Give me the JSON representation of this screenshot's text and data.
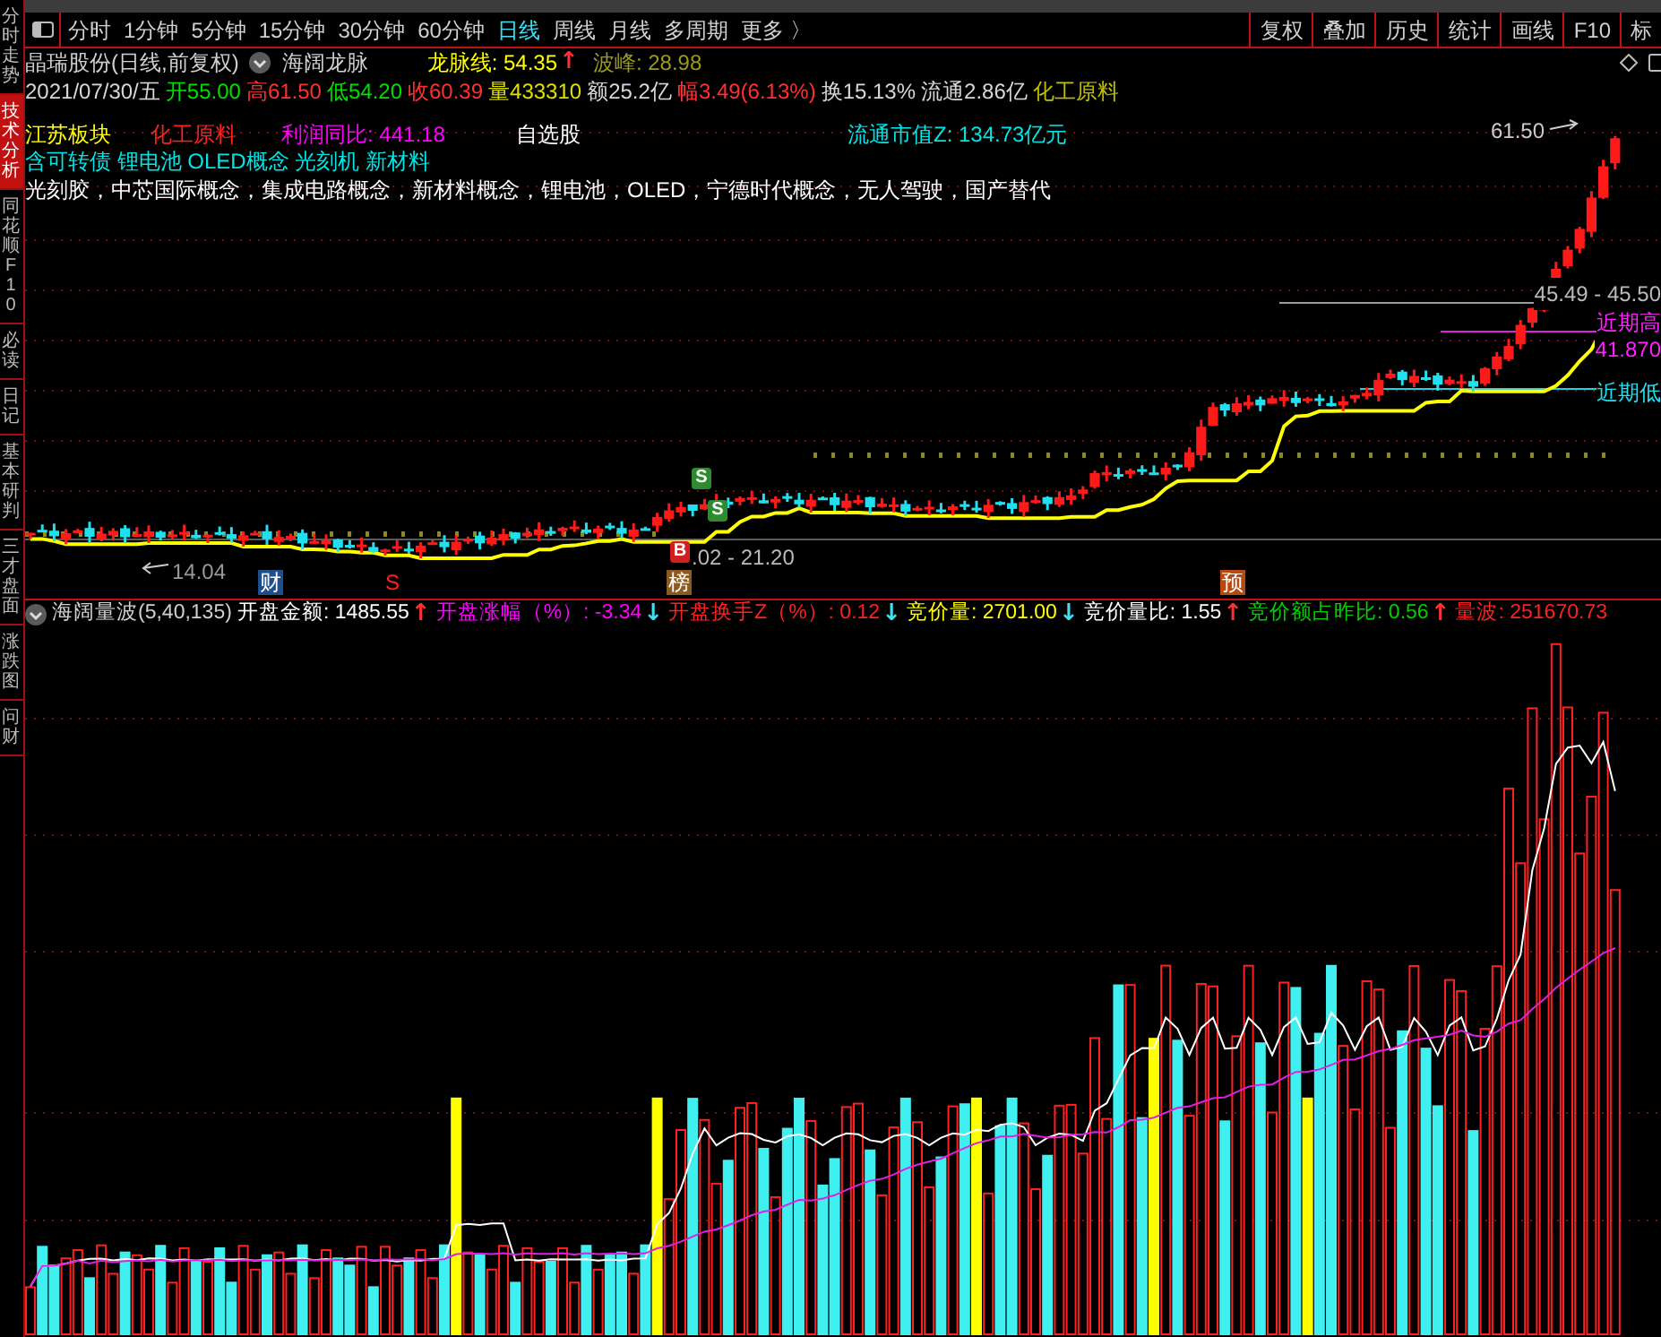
{
  "side_tabs": [
    {
      "label": "分时走势",
      "selected": false
    },
    {
      "label": "技术分析",
      "selected": true
    },
    {
      "label": "同花顺F10",
      "selected": false
    },
    {
      "label": "必读",
      "selected": false
    },
    {
      "label": "日记",
      "selected": false
    },
    {
      "label": "基本研判",
      "selected": false
    },
    {
      "label": "三才盘面",
      "selected": false
    },
    {
      "label": "涨跌图",
      "selected": false
    },
    {
      "label": "问财",
      "selected": false
    }
  ],
  "toolbar": {
    "periods": [
      {
        "label": "分时",
        "selected": false
      },
      {
        "label": "1分钟",
        "selected": false
      },
      {
        "label": "5分钟",
        "selected": false
      },
      {
        "label": "15分钟",
        "selected": false
      },
      {
        "label": "30分钟",
        "selected": false
      },
      {
        "label": "60分钟",
        "selected": false
      },
      {
        "label": "日线",
        "selected": true
      },
      {
        "label": "周线",
        "selected": false
      },
      {
        "label": "月线",
        "selected": false
      },
      {
        "label": "多周期",
        "selected": false
      },
      {
        "label": "更多 〉",
        "selected": false
      }
    ],
    "buttons": [
      "复权",
      "叠加",
      "历史",
      "统计",
      "画线",
      "F10",
      "标"
    ]
  },
  "header": {
    "stock": "晶瑞股份(日线,前复权)",
    "indicator": "海阔龙脉",
    "readings": [
      {
        "label": "龙脉线: 54.35",
        "color": "#ffff00",
        "arrow": {
          "text": "↑",
          "color": "#ff3030"
        }
      },
      {
        "label": "波峰: 28.98",
        "color": "#9a9a20"
      }
    ]
  },
  "quote": [
    {
      "text": "2021/07/30/五",
      "color": "#d8d8d8"
    },
    {
      "text": "开55.00",
      "color": "#00e000"
    },
    {
      "text": "高61.50",
      "color": "#ff3030"
    },
    {
      "text": "低54.20",
      "color": "#00e000"
    },
    {
      "text": "收60.39",
      "color": "#ff3030"
    },
    {
      "text": "量433310",
      "color": "#e0e000"
    },
    {
      "text": "额25.2亿",
      "color": "#d8d8d8"
    },
    {
      "text": "幅3.49(6.13%)",
      "color": "#ff3030"
    },
    {
      "text": "换15.13%",
      "color": "#d8d8d8"
    },
    {
      "text": "流通2.86亿",
      "color": "#d8d8d8"
    },
    {
      "text": "化工原料",
      "color": "#c0c000"
    }
  ],
  "price_chart": {
    "tags": [
      {
        "text": "江苏板块",
        "color": "#ffff00"
      },
      {
        "text": "化工原料",
        "color": "#ff2020"
      },
      {
        "text": "利润同比: 441.18",
        "color": "#ff00ff"
      },
      {
        "text": "自选股",
        "color": "#ffffff"
      },
      {
        "text": "流通市值Z: 134.73亿元",
        "color": "#00e5e5"
      }
    ],
    "concepts": "含可转债 锂电池 OLED概念 光刻机 新材料",
    "themes": "光刻胶，中芯国际概念，集成电路概念，新材料概念，锂电池，OLED，宁德时代概念，无人驾驶，国产替代",
    "high_label": "61.50",
    "range_label": "45.49 - 45.50",
    "recent_high": "近期高",
    "recent_high_value": "41.870",
    "recent_low": "近期低",
    "low_range_label": ".02 - 21.20",
    "low_label": "14.04",
    "signals": [
      {
        "text": "S",
        "color": "#2e8b2e"
      },
      {
        "text": "S",
        "color": "#2e8b2e"
      },
      {
        "text": "B",
        "color": "#d02020"
      }
    ],
    "markers": [
      {
        "text": "财",
        "color": "#1f4f8a"
      },
      {
        "text": "S",
        "color": "#000000"
      },
      {
        "text": "榜",
        "color": "#8a5a20"
      },
      {
        "text": "预",
        "color": "#b84a10"
      }
    ]
  },
  "volume_pane": {
    "title": "海阔量波(5,40,135)",
    "readings": [
      {
        "label": "开盘金额: 1485.55",
        "color": "#ffffff",
        "arrow": {
          "text": "↑",
          "color": "#ff3030"
        }
      },
      {
        "label": "开盘涨幅（%）: -3.34",
        "color": "#ff00ff",
        "arrow": {
          "text": "↓",
          "color": "#40e0f0"
        }
      },
      {
        "label": "开盘换手Z（%）: 0.12",
        "color": "#ff2020",
        "arrow": {
          "text": "↓",
          "color": "#40e0f0"
        }
      },
      {
        "label": "竞价量: 2701.00",
        "color": "#ffff00",
        "arrow": {
          "text": "↓",
          "color": "#40e0f0"
        }
      },
      {
        "label": "竞价量比: 1.55",
        "color": "#ffffff",
        "arrow": {
          "text": "↑",
          "color": "#ff3030"
        }
      },
      {
        "label": "竞价额占昨比: 0.56",
        "color": "#00d000",
        "arrow": {
          "text": "↑",
          "color": "#ff3030"
        }
      },
      {
        "label": "量波: 251670.73",
        "color": "#ff2020"
      }
    ]
  }
}
